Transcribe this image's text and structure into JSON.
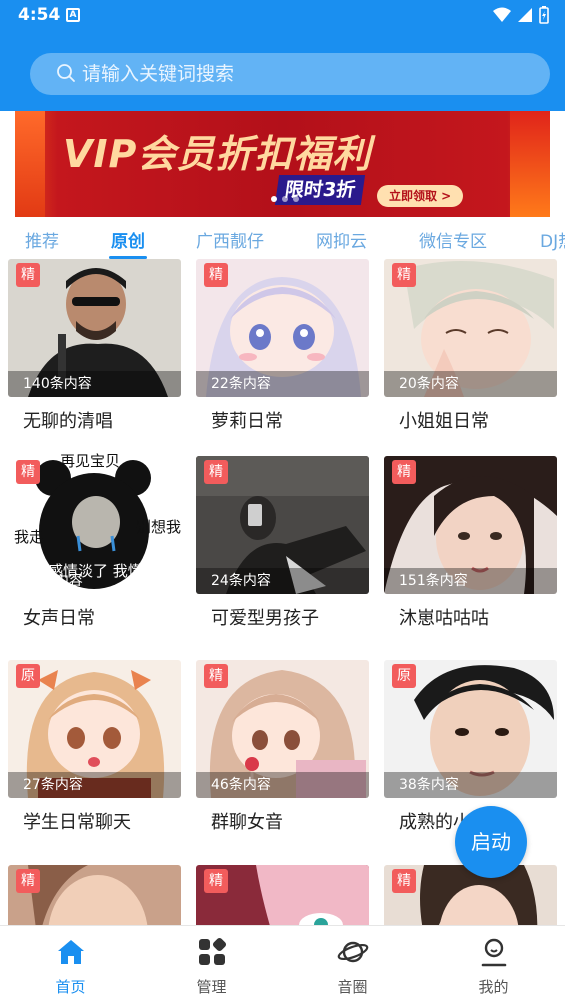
{
  "status_bar": {
    "time": "4:54",
    "notification_glyph": "A"
  },
  "search": {
    "placeholder": "请输入关键词搜索"
  },
  "banner": {
    "title": "VIP会员折扣福利",
    "subtitle": "限时3折",
    "button": "立即领取 >"
  },
  "tabs": [
    "推荐",
    "原创",
    "广西靓仔",
    "网抑云",
    "微信专区",
    "DJ热"
  ],
  "active_tab": "原创",
  "cards": [
    {
      "tag": "精",
      "count": "140条内容",
      "title": "无聊的清唱"
    },
    {
      "tag": "精",
      "count": "22条内容",
      "title": "萝莉日常"
    },
    {
      "tag": "精",
      "count": "20条内容",
      "title": "小姐姐日常"
    },
    {
      "tag": "精",
      "count": "38条内容",
      "title": "女声日常",
      "meme": {
        "top": "再见宝贝",
        "left": "我走",
        "right": "别想我",
        "bottom": "感情淡了 我懂"
      }
    },
    {
      "tag": "精",
      "count": "24条内容",
      "title": "可爱型男孩子"
    },
    {
      "tag": "精",
      "count": "151条内容",
      "title": "沐崽咕咕咕"
    },
    {
      "tag": "原",
      "count": "27条内容",
      "title": "学生日常聊天"
    },
    {
      "tag": "精",
      "count": "46条内容",
      "title": "群聊女音"
    },
    {
      "tag": "原",
      "count": "38条内容",
      "title": "成熟的小"
    },
    {
      "tag": "精",
      "count": "",
      "title": ""
    },
    {
      "tag": "精",
      "count": "",
      "title": ""
    },
    {
      "tag": "精",
      "count": "",
      "title": ""
    }
  ],
  "fab": {
    "label": "启动"
  },
  "bottom_nav": [
    {
      "label": "首页",
      "icon": "home-icon",
      "active": true
    },
    {
      "label": "管理",
      "icon": "grid-icon",
      "active": false
    },
    {
      "label": "音圈",
      "icon": "planet-icon",
      "active": false
    },
    {
      "label": "我的",
      "icon": "user-icon",
      "active": false
    }
  ],
  "colors": {
    "primary": "#1a8ff0",
    "tag_red": "#f25c5c",
    "banner_red": "#b3101a"
  }
}
